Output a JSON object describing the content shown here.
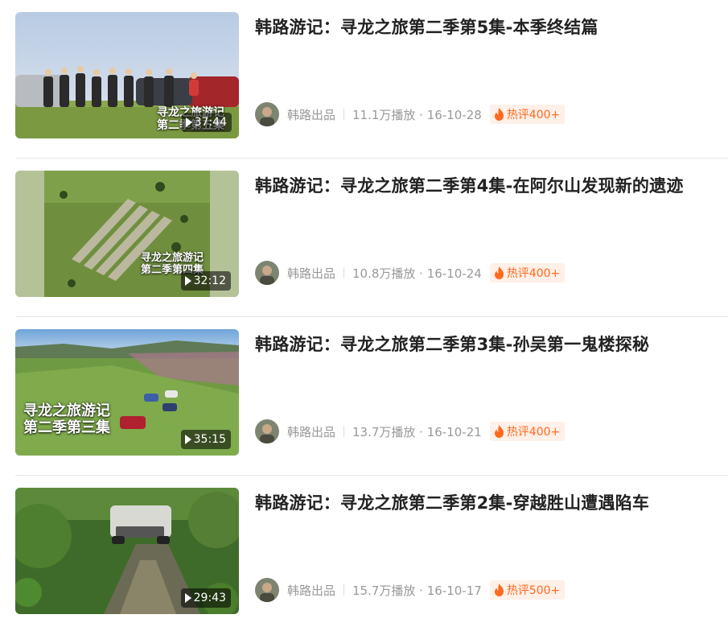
{
  "videos": [
    {
      "title": "韩路游记：寻龙之旅第二季第5集-本季终结篇",
      "duration": "37:44",
      "overlay": "寻龙之旅游记\n第二季第五集",
      "thumbnail": "group-photo-with-suvs",
      "author": "韩路出品",
      "stats": "11.1万播放 · 16-10-28",
      "hot": "热评400+"
    },
    {
      "title": "韩路游记：寻龙之旅第二季第4集-在阿尔山发现新的遗迹",
      "duration": "32:12",
      "overlay": "寻龙之旅游记\n第二季第四集",
      "thumbnail": "aerial-ruins-green-hill",
      "author": "韩路出品",
      "stats": "10.8万播放 · 16-10-24",
      "hot": "热评400+"
    },
    {
      "title": "韩路游记：寻龙之旅第二季第3集-孙吴第一鬼楼探秘",
      "duration": "35:15",
      "overlay": "寻龙之旅游记\n第二季第三集",
      "thumbnail": "aerial-cars-on-meadow",
      "author": "韩路出品",
      "stats": "13.7万播放 · 16-10-21",
      "hot": "热评400+"
    },
    {
      "title": "韩路游记：寻龙之旅第二季第2集-穿越胜山遭遇陷车",
      "duration": "29:43",
      "overlay": "",
      "thumbnail": "suv-muddy-forest-trail",
      "author": "韩路出品",
      "stats": "15.7万播放 · 16-10-17",
      "hot": "热评500+"
    }
  ],
  "colors": {
    "title": "#222222",
    "meta": "#999999",
    "hot_text": "#ff6a1f",
    "hot_bg": "#fff0e8",
    "divider": "#e8e8e8"
  }
}
